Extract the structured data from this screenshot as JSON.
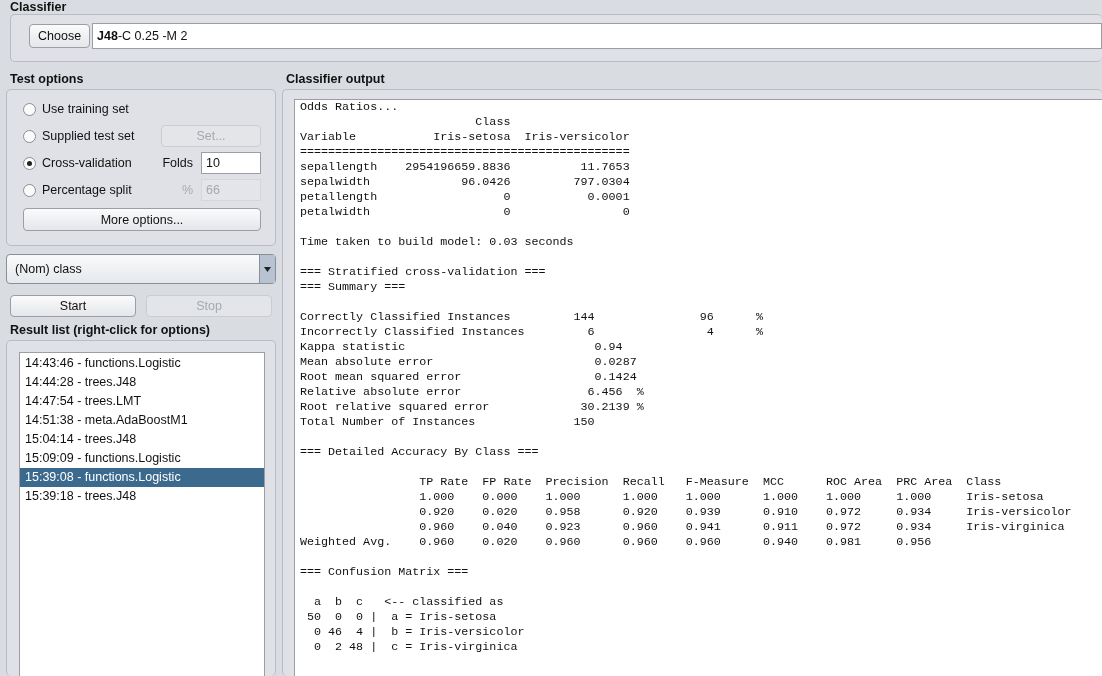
{
  "classifier": {
    "heading": "Classifier",
    "choose_button": "Choose",
    "name": "J48",
    "options": "-C 0.25 -M 2"
  },
  "test_options": {
    "heading": "Test options",
    "options": [
      {
        "label": "Use training set",
        "selected": false,
        "kind": "plain"
      },
      {
        "label": "Supplied test set",
        "selected": false,
        "kind": "button",
        "button": "Set...",
        "disabled": true
      },
      {
        "label": "Cross-validation",
        "selected": true,
        "kind": "field",
        "field_label": "Folds",
        "value": "10",
        "disabled": false
      },
      {
        "label": "Percentage split",
        "selected": false,
        "kind": "field",
        "field_label": "%",
        "value": "66",
        "disabled": true
      }
    ],
    "more_button": "More options..."
  },
  "class_select": {
    "value": "(Nom) class"
  },
  "start_button": {
    "label": "Start",
    "disabled": false
  },
  "stop_button": {
    "label": "Stop",
    "disabled": true
  },
  "result_list": {
    "heading": "Result list (right-click for options)",
    "items": [
      {
        "label": "14:43:46 - functions.Logistic",
        "selected": false
      },
      {
        "label": "14:44:28 - trees.J48",
        "selected": false
      },
      {
        "label": "14:47:54 - trees.LMT",
        "selected": false
      },
      {
        "label": "14:51:38 - meta.AdaBoostM1",
        "selected": false
      },
      {
        "label": "15:04:14 - trees.J48",
        "selected": false
      },
      {
        "label": "15:09:09 - functions.Logistic",
        "selected": false
      },
      {
        "label": "15:39:08 - functions.Logistic",
        "selected": true
      },
      {
        "label": "15:39:18 - trees.J48",
        "selected": false
      }
    ]
  },
  "output": {
    "heading": "Classifier output",
    "blocks": [
      {
        "lines": [
          "Odds Ratios...",
          "                         Class",
          "Variable           Iris-setosa  Iris-versicolor",
          "===============================================",
          "sepallength    2954196659.8836          11.7653",
          "sepalwidth             96.0426         797.0304",
          "petallength                  0           0.0001",
          "petalwidth                   0                0"
        ]
      },
      {
        "lines": [
          "Time taken to build model: 0.03 seconds"
        ]
      },
      {
        "lines": [
          "=== Stratified cross-validation ===",
          "=== Summary ==="
        ]
      },
      {
        "lines": [
          "Correctly Classified Instances         144               96      %",
          "Incorrectly Classified Instances         6                4      %",
          "Kappa statistic                           0.94",
          "Mean absolute error                       0.0287",
          "Root mean squared error                   0.1424",
          "Relative absolute error                  6.456  %",
          "Root relative squared error             30.2139 %",
          "Total Number of Instances              150"
        ]
      },
      {
        "lines": [
          "=== Detailed Accuracy By Class ==="
        ]
      },
      {
        "lines": [
          "                 TP Rate  FP Rate  Precision  Recall   F-Measure  MCC      ROC Area  PRC Area  Class",
          "                 1.000    0.000    1.000      1.000    1.000      1.000    1.000     1.000     Iris-setosa",
          "                 0.920    0.020    0.958      0.920    0.939      0.910    0.972     0.934     Iris-versicolor",
          "                 0.960    0.040    0.923      0.960    0.941      0.911    0.972     0.934     Iris-virginica",
          "Weighted Avg.    0.960    0.020    0.960      0.960    0.960      0.940    0.981     0.956"
        ]
      },
      {
        "lines": [
          "=== Confusion Matrix ==="
        ]
      },
      {
        "lines": [
          "  a  b  c   <-- classified as",
          " 50  0  0 |  a = Iris-setosa",
          "  0 46  4 |  b = Iris-versicolor",
          "  0  2 48 |  c = Iris-virginica"
        ]
      }
    ]
  }
}
